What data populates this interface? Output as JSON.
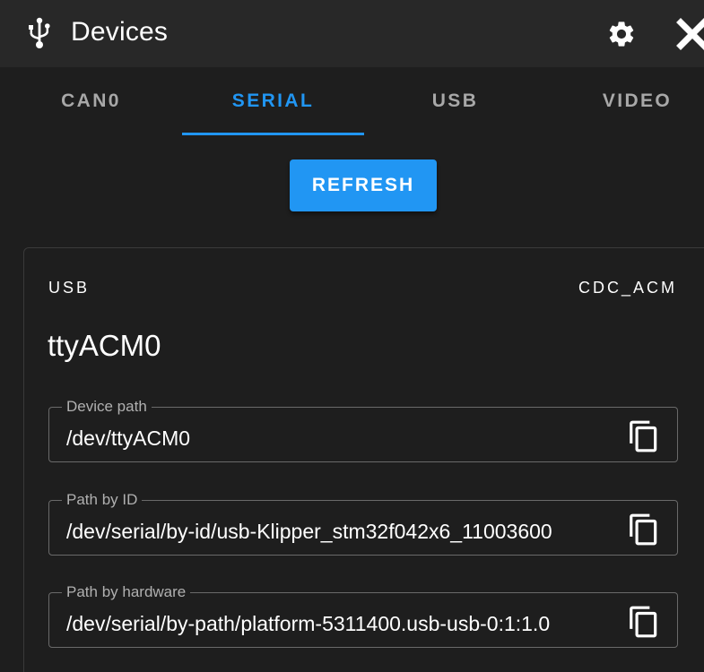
{
  "window": {
    "title": "Devices",
    "title_icon": "usb-icon",
    "settings_icon": "gear-icon",
    "close_icon": "close-icon"
  },
  "tabs": [
    {
      "label": "CAN0",
      "active": false
    },
    {
      "label": "SERIAL",
      "active": true
    },
    {
      "label": "USB",
      "active": false
    },
    {
      "label": "VIDEO",
      "active": false
    }
  ],
  "toolbar": {
    "refresh_label": "REFRESH"
  },
  "device": {
    "bus": "USB",
    "driver": "CDC_ACM",
    "name": "ttyACM0",
    "fields": [
      {
        "label": "Device path",
        "value": "/dev/ttyACM0",
        "action_icon": "copy-icon"
      },
      {
        "label": "Path by ID",
        "value": "/dev/serial/by-id/usb-Klipper_stm32f042x6_11003600",
        "action_icon": "copy-icon"
      },
      {
        "label": "Path by hardware",
        "value": "/dev/serial/by-path/platform-5311400.usb-usb-0:1:1.0",
        "action_icon": "copy-icon"
      }
    ]
  },
  "colors": {
    "accent": "#2196f3",
    "background": "#1e1e1e",
    "titlebar": "#282828",
    "inactive_tab": "#a8a8a8"
  }
}
